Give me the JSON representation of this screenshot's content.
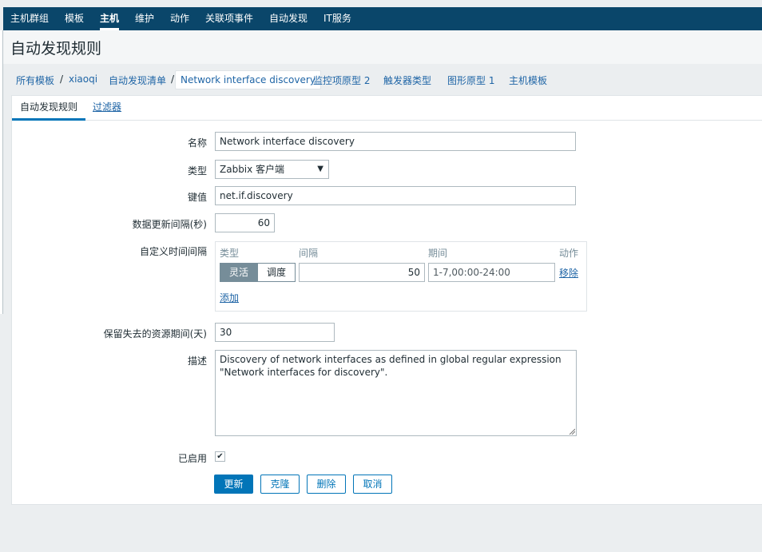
{
  "nav": {
    "items": [
      "主机群组",
      "模板",
      "主机",
      "维护",
      "动作",
      "关联项事件",
      "自动发现",
      "IT服务"
    ],
    "active_index": 2
  },
  "header": {
    "title": "自动发现规则"
  },
  "breadcrumb": {
    "all_templates": "所有模板",
    "sep": "/",
    "template": "xiaoqi",
    "discovery_list": "自动发现清单",
    "current": "Network interface discovery",
    "item_prototypes": "监控项原型 2",
    "trigger_types": "触发器类型",
    "graph_prototypes": "图形原型 1",
    "host_templates": "主机模板"
  },
  "tabs": {
    "rule": "自动发现规则",
    "filters": "过滤器"
  },
  "form": {
    "name_label": "名称",
    "name_value": "Network interface discovery",
    "type_label": "类型",
    "type_value": "Zabbix 客户端",
    "key_label": "键值",
    "key_value": "net.if.discovery",
    "interval_label": "数据更新间隔(秒)",
    "interval_value": "60",
    "custom_label": "自定义时间间隔",
    "custom": {
      "col_type": "类型",
      "col_interval": "间隔",
      "col_period": "期间",
      "col_action": "动作",
      "seg_flexible": "灵活",
      "seg_scheduling": "调度",
      "interval_value": "50",
      "period_value": "1-7,00:00-24:00",
      "remove": "移除",
      "add": "添加"
    },
    "keep_lost_label": "保留失去的资源期间(天)",
    "keep_lost_value": "30",
    "desc_label": "描述",
    "desc_value": "Discovery of network interfaces as defined in global regular expression \"Network interfaces for discovery\".",
    "enabled_label": "已启用",
    "enabled_checked": true
  },
  "buttons": {
    "update": "更新",
    "clone": "克隆",
    "delete": "删除",
    "cancel": "取消"
  },
  "colors": {
    "nav_bg": "#0a466a",
    "primary": "#0275b8",
    "link": "#1f65a6"
  }
}
